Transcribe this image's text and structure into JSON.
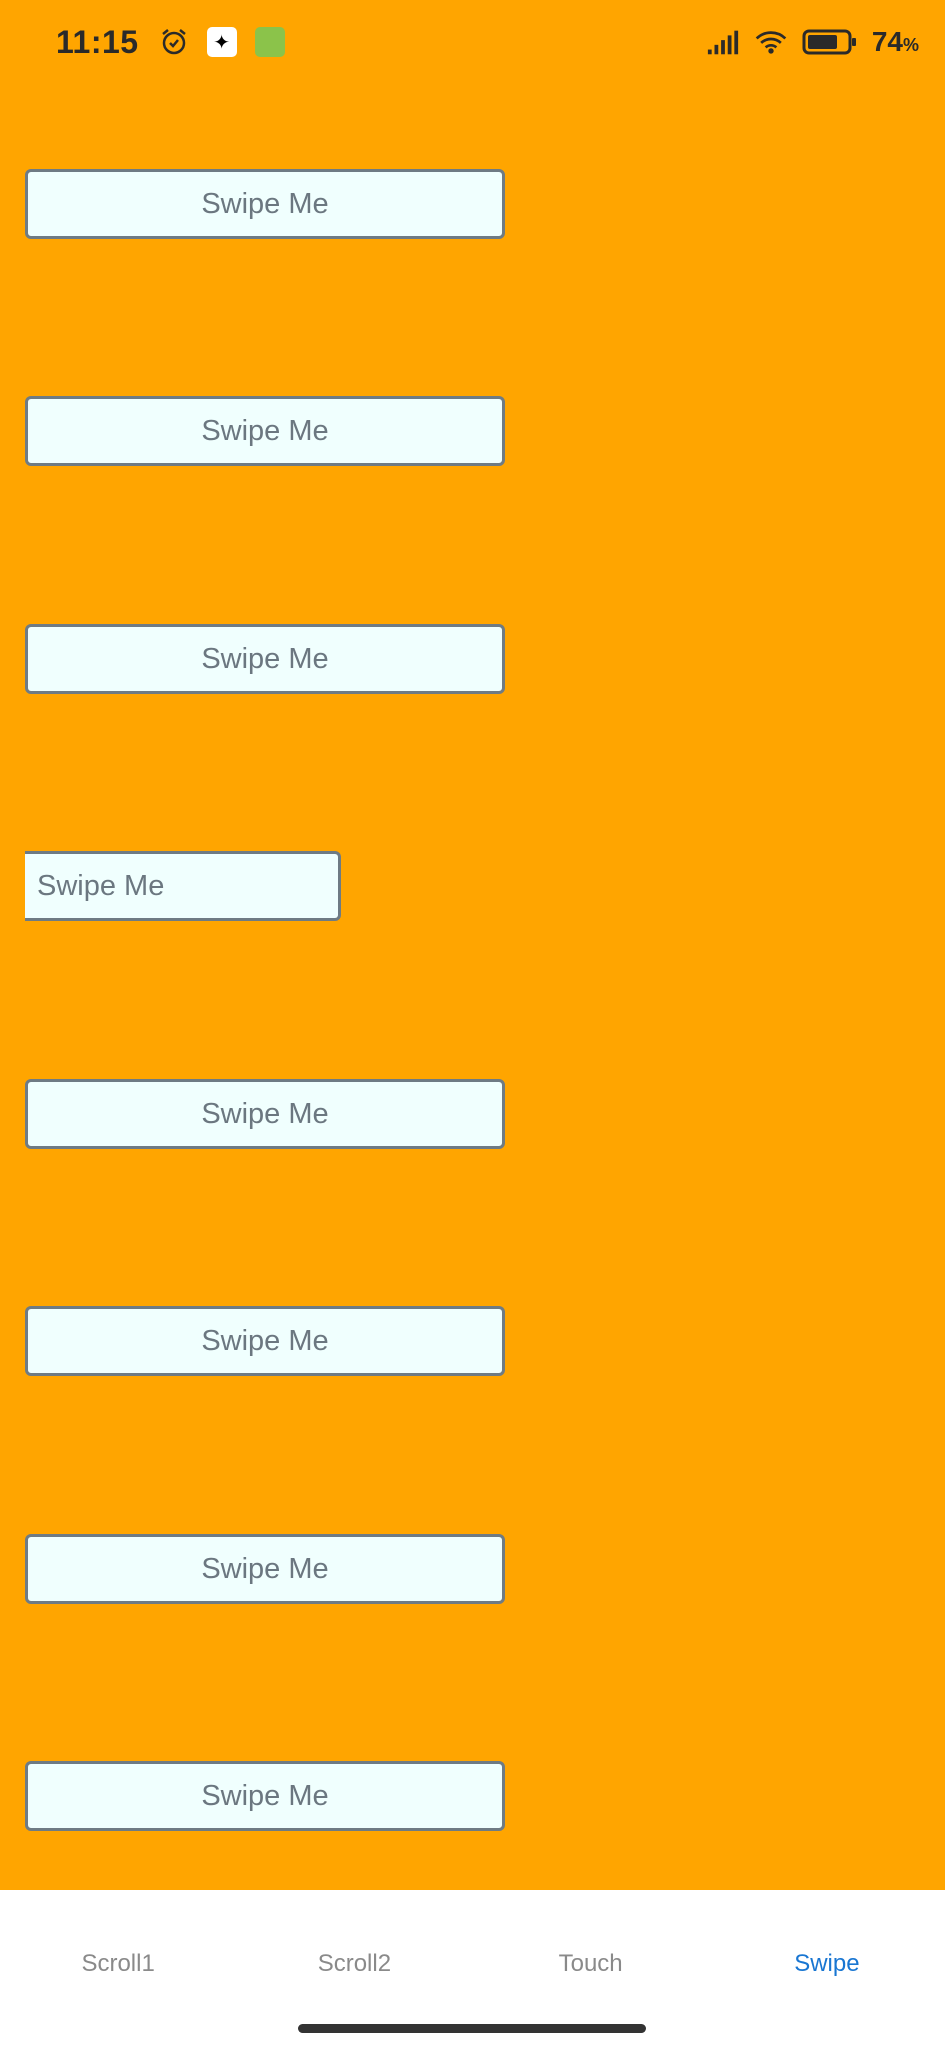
{
  "status": {
    "time": "11:15",
    "battery_percent": "74",
    "battery_unit": "%",
    "icons": [
      "alarm-icon",
      "app-icon-white",
      "app-icon-green",
      "signal-icon",
      "wifi-icon",
      "battery-icon"
    ]
  },
  "swipe_buttons": [
    {
      "label": "Swipe Me"
    },
    {
      "label": "Swipe Me"
    },
    {
      "label": "Swipe Me"
    },
    {
      "label": "Swipe Me"
    },
    {
      "label": "Swipe Me"
    },
    {
      "label": "Swipe Me"
    },
    {
      "label": "Swipe Me"
    },
    {
      "label": "Swipe Me"
    }
  ],
  "tabs": [
    {
      "label": "Scroll1"
    },
    {
      "label": "Scroll2"
    },
    {
      "label": "Touch"
    },
    {
      "label": "Swipe"
    }
  ],
  "colors": {
    "background": "#ffa500",
    "button_fill": "#f0fffe",
    "active_tab": "#1976d2"
  }
}
